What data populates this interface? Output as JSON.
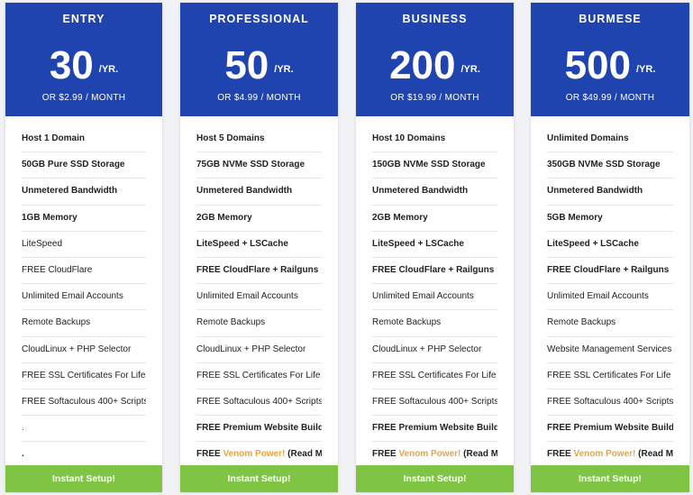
{
  "colors": {
    "header_bg": "#1f44b0",
    "cta_bg": "#7fc543",
    "venom": "#e8a33a"
  },
  "plans": [
    {
      "name": "ENTRY",
      "price": "30",
      "unit": "/YR.",
      "monthly": "OR $2.99 / MONTH",
      "features": [
        {
          "text": "Host 1 Domain",
          "bold": true
        },
        {
          "text": "50GB Pure SSD Storage",
          "bold": true
        },
        {
          "text": "Unmetered Bandwidth",
          "bold": true
        },
        {
          "text": "1GB Memory",
          "bold": true
        },
        {
          "text": "LiteSpeed",
          "bold": false
        },
        {
          "text": "FREE CloudFlare",
          "bold": false
        },
        {
          "text": "Unlimited Email Accounts",
          "bold": false
        },
        {
          "text": "Remote Backups",
          "bold": false
        },
        {
          "text": "CloudLinux + PHP Selector",
          "bold": false
        },
        {
          "text": "FREE SSL Certificates For Life",
          "bold": false
        },
        {
          "text": "FREE Softaculous 400+ Scripts",
          "bold": false
        },
        {
          "text": ".",
          "bold": false
        },
        {
          "text": ".",
          "bold": true
        }
      ],
      "cta": "Instant Setup!"
    },
    {
      "name": "PROFESSIONAL",
      "price": "50",
      "unit": "/YR.",
      "monthly": "OR $4.99 / MONTH",
      "features": [
        {
          "text": "Host 5 Domains",
          "bold": true
        },
        {
          "text": "75GB NVMe SSD Storage",
          "bold": true
        },
        {
          "text": "Unmetered Bandwidth",
          "bold": true
        },
        {
          "text": "2GB Memory",
          "bold": true
        },
        {
          "text": "LiteSpeed + LSCache",
          "bold": true
        },
        {
          "text": "FREE CloudFlare + Railguns",
          "bold": true
        },
        {
          "text": "Unlimited Email Accounts",
          "bold": false
        },
        {
          "text": "Remote Backups",
          "bold": false
        },
        {
          "text": "CloudLinux + PHP Selector",
          "bold": false
        },
        {
          "text": "FREE SSL Certificates For Life",
          "bold": false
        },
        {
          "text": "FREE Softaculous 400+ Scripts",
          "bold": false
        },
        {
          "text": "FREE Premium Website Builder",
          "bold": true
        },
        {
          "pre": "FREE ",
          "venom": "Venom Power!",
          "post": " (Read More)",
          "bold": true
        }
      ],
      "cta": "Instant Setup!"
    },
    {
      "name": "BUSINESS",
      "price": "200",
      "unit": "/YR.",
      "monthly": "OR $19.99 / MONTH",
      "features": [
        {
          "text": "Host 10 Domains",
          "bold": true
        },
        {
          "text": "150GB NVMe SSD Storage",
          "bold": true
        },
        {
          "text": "Unmetered Bandwidth",
          "bold": true
        },
        {
          "text": "2GB Memory",
          "bold": true
        },
        {
          "text": "LiteSpeed + LSCache",
          "bold": true
        },
        {
          "text": "FREE CloudFlare + Railguns",
          "bold": true
        },
        {
          "text": "Unlimited Email Accounts",
          "bold": false
        },
        {
          "text": "Remote Backups",
          "bold": false
        },
        {
          "text": "CloudLinux + PHP Selector",
          "bold": false
        },
        {
          "text": "FREE SSL Certificates For Life",
          "bold": false
        },
        {
          "text": "FREE Softaculous 400+ Scripts",
          "bold": false
        },
        {
          "text": "FREE Premium Website Builder",
          "bold": true
        },
        {
          "pre": "FREE ",
          "venom": "Venom Power!",
          "post": " (Read More)",
          "bold": true
        }
      ],
      "cta": "Instant Setup!"
    },
    {
      "name": "BURMESE",
      "price": "500",
      "unit": "/YR.",
      "monthly": "OR $49.99 / MONTH",
      "features": [
        {
          "text": "Unlimited Domains",
          "bold": true
        },
        {
          "text": "350GB NVMe SSD Storage",
          "bold": true
        },
        {
          "text": "Unmetered Bandwidth",
          "bold": true
        },
        {
          "text": "5GB Memory",
          "bold": true
        },
        {
          "text": "LiteSpeed + LSCache",
          "bold": true
        },
        {
          "text": "FREE CloudFlare + Railguns",
          "bold": true
        },
        {
          "text": "Unlimited Email Accounts",
          "bold": false
        },
        {
          "text": "Remote Backups",
          "bold": false
        },
        {
          "text": "Website Management Services",
          "bold": false
        },
        {
          "text": "FREE SSL Certificates For Life",
          "bold": false
        },
        {
          "text": "FREE Softaculous 400+ Scripts",
          "bold": false
        },
        {
          "text": "FREE Premium Website Builder",
          "bold": true
        },
        {
          "pre": "FREE ",
          "venom": "Venom Power!",
          "post": " (Read More)",
          "bold": true
        }
      ],
      "cta": "Instant Setup!"
    }
  ]
}
